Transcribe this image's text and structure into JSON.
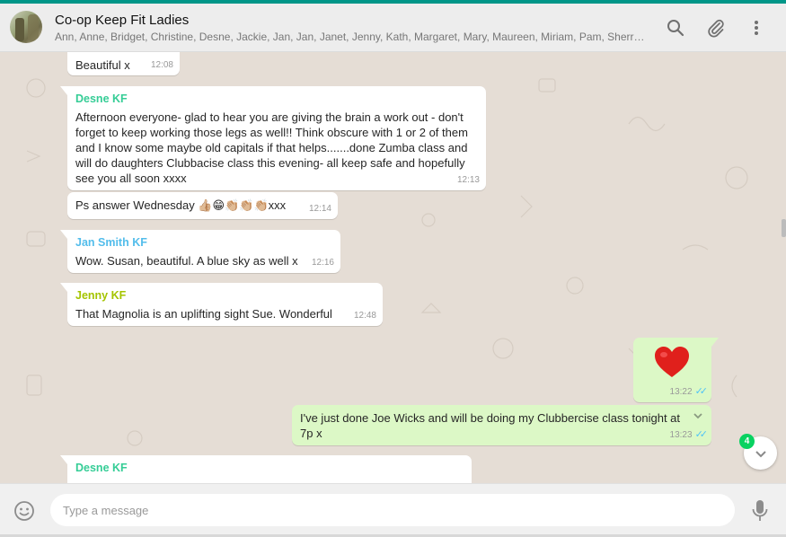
{
  "header": {
    "title": "Co-op Keep Fit Ladies",
    "members": "Ann, Anne, Bridget, Christine, Desne, Jackie, Jan, Jan, Janet, Jenny, Kath, Margaret, Mary, Maureen, Miriam, Pam, Sherry, Sue, S...",
    "icons": [
      "search-icon",
      "attach-icon",
      "menu-icon"
    ]
  },
  "messages": [
    {
      "text": "Beautiful x",
      "time": "12:08"
    },
    {
      "sender": "Desne KF",
      "sender_color": "#35cd96",
      "text": "Afternoon everyone- glad to hear you are giving the brain a work out - don't forget to keep working  those legs as well!! Think obscure with 1 or 2 of them and I know some maybe old capitals if that helps.......done Zumba class and will do daughters Clubbacise class this evening- all keep safe and hopefully see you all soon xxxx",
      "time": "12:13"
    },
    {
      "text": "Ps answer Wednesday 👍🏼😁👏🏼👏🏼👏🏼xxx",
      "time": "12:14"
    },
    {
      "sender": "Jan Smith KF",
      "sender_color": "#53bdeb",
      "text": "Wow. Susan, beautiful. A blue sky as well x",
      "time": "12:16"
    },
    {
      "sender": "Jenny KF",
      "sender_color": "#a4c400",
      "text": "That Magnolia is an uplifting sight  Sue. Wonderful",
      "time": "12:48"
    },
    {
      "text": "❤️",
      "time": "13:22",
      "outgoing": true
    },
    {
      "text": "I've just done Joe Wicks and will be doing my Clubbercise class tonight at 7p x",
      "time": "13:23",
      "outgoing": true
    },
    {
      "sender": "Desne KF",
      "sender_color": "#35cd96",
      "text": ""
    }
  ],
  "scroll_button": {
    "unread_count": "4"
  },
  "composer": {
    "placeholder": "Type a message"
  },
  "colors": {
    "accent": "#009688",
    "outgoing_bubble": "#dcf8c6",
    "incoming_bubble": "#ffffff",
    "read_ticks": "#4fc3f7"
  }
}
